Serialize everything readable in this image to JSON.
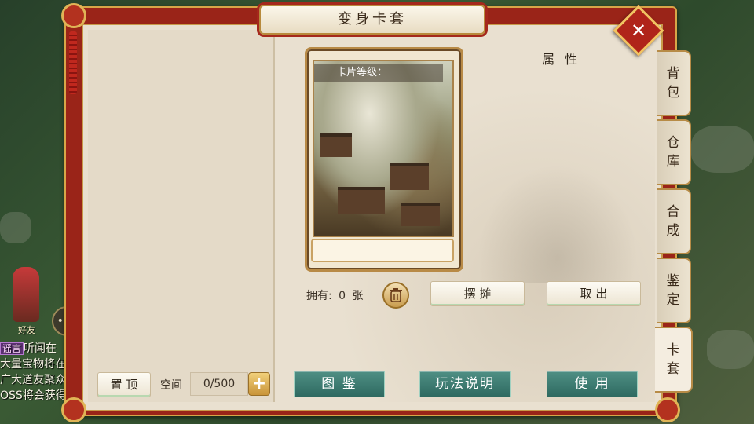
{
  "window": {
    "title": "变身卡套",
    "close_label": "✕"
  },
  "card": {
    "level_label": "卡片等级："
  },
  "attributes": {
    "title": "属 性"
  },
  "ownership": {
    "label": "拥有: 0 张"
  },
  "buttons": {
    "stall": "摆 摊",
    "take_out": "取 出",
    "pin_top": "置 顶",
    "gallery": "图 鉴",
    "gameplay_help": "玩法说明",
    "use": "使 用"
  },
  "storage": {
    "space_label": "空间",
    "space_value": "0/500",
    "add_label": "+"
  },
  "side_tabs": [
    {
      "label": "背包",
      "active": false
    },
    {
      "label": "仓库",
      "active": false
    },
    {
      "label": "合成",
      "active": false
    },
    {
      "label": "鉴定",
      "active": false
    },
    {
      "label": "卡套",
      "active": true
    }
  ],
  "background": {
    "friend_label": "好友",
    "chat": [
      {
        "tag": "谣言",
        "text": "听闻在"
      },
      {
        "tag": "",
        "text": "大量宝物将在"
      },
      {
        "tag": "",
        "text": "广大道友聚众"
      },
      {
        "tag": "",
        "text": "OSS将会获得"
      }
    ]
  },
  "colors": {
    "frame_red": "#9a2418",
    "gold_trim": "#d7a648",
    "parchment": "#e9e0d0",
    "teal_button": "#2f6a61"
  },
  "icons": {
    "close": "close-icon",
    "trash": "trash-icon",
    "plus": "plus-icon",
    "chat": "chat-bubble-icon"
  }
}
